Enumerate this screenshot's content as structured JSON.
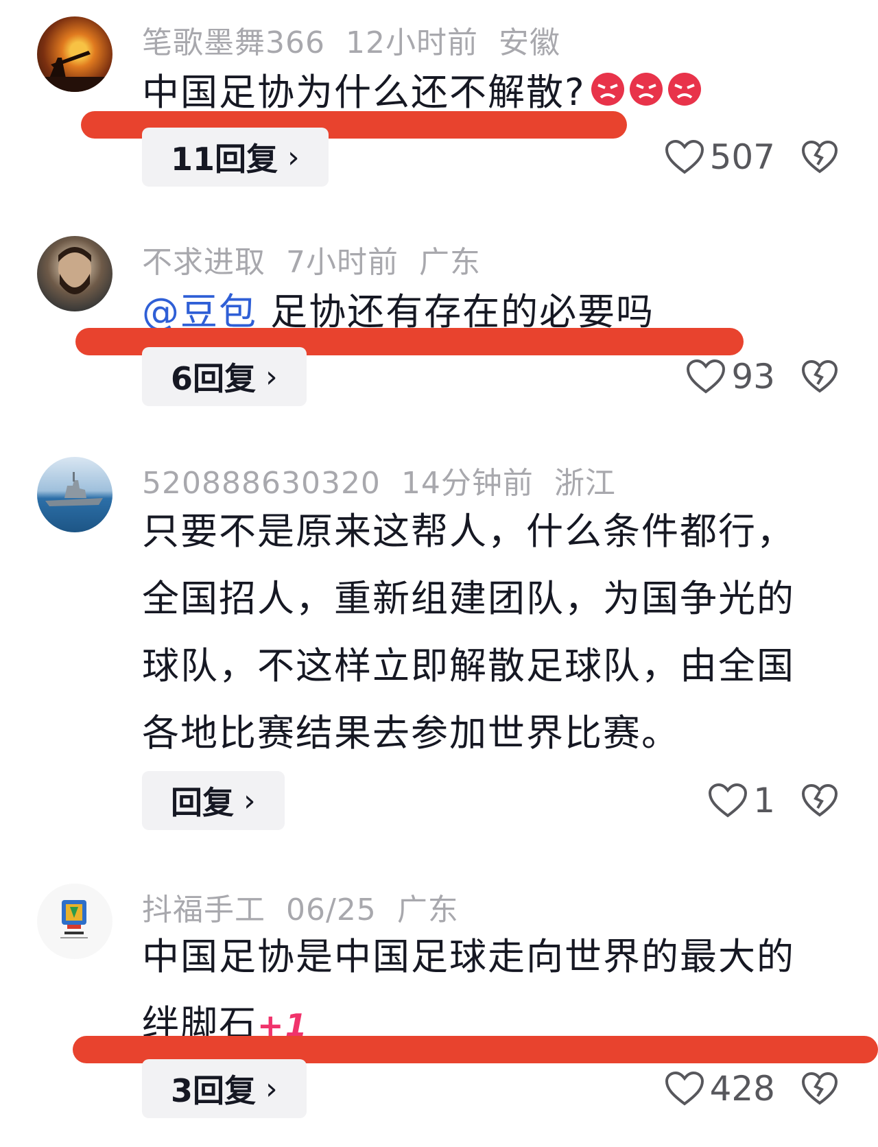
{
  "comments": [
    {
      "username": "笔歌墨舞366",
      "time": "12小时前",
      "location": "安徽",
      "text": "中国足协为什么还不解散?",
      "emoji": "angry-face-emoji",
      "reply_label": "11回复",
      "likes": "507"
    },
    {
      "username": "不求进取",
      "time": "7小时前",
      "location": "广东",
      "mention": "@豆包",
      "text": "足协还有存在的必要吗",
      "reply_label": "6回复",
      "likes": "93"
    },
    {
      "username": "520888630320",
      "time": "14分钟前",
      "location": "浙江",
      "text_lines": [
        "只要不是原来这帮人，什么条件都行，",
        "全国招人，重新组建团队，为国争光的",
        "球队，不这样立即解散足球队，由全国",
        "各地比赛结果去参加世界比赛。"
      ],
      "reply_label": "回复",
      "likes": "1"
    },
    {
      "username": "抖福手工",
      "time": "06/25",
      "location": "广东",
      "text_lines": [
        "中国足协是中国足球走向世界的最大的",
        "绊脚石"
      ],
      "plus": "+1",
      "reply_label": "3回复",
      "likes": "428"
    }
  ],
  "colors": {
    "redline": "#e8432e",
    "meta": "#a8a8ad",
    "mention": "#2f5fd6"
  }
}
